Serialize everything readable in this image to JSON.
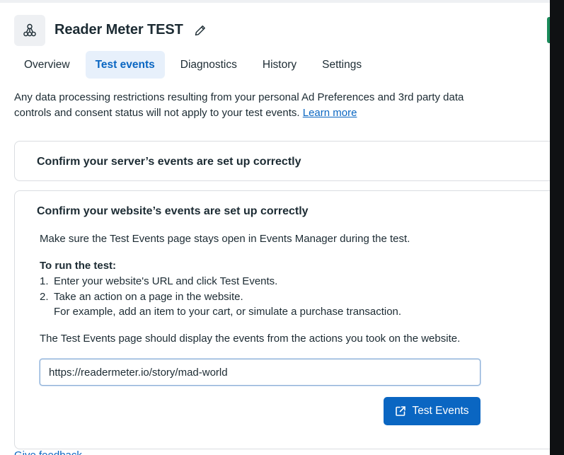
{
  "header": {
    "title": "Reader Meter TEST",
    "icons": {
      "app": "network-nodes-icon",
      "edit": "pencil-icon"
    }
  },
  "tabs": [
    {
      "label": "Overview",
      "active": false
    },
    {
      "label": "Test events",
      "active": true
    },
    {
      "label": "Diagnostics",
      "active": false
    },
    {
      "label": "History",
      "active": false
    },
    {
      "label": "Settings",
      "active": false
    }
  ],
  "notice": {
    "text": "Any data processing restrictions resulting from your personal Ad Preferences and 3rd party data controls and consent status will not apply to your test events.",
    "link": "Learn more"
  },
  "server_card": {
    "title": "Confirm your server’s events are set up correctly"
  },
  "website_card": {
    "title": "Confirm your website’s events are set up correctly",
    "intro": "Make sure the Test Events page stays open in Events Manager during the test.",
    "run_title": "To run the test:",
    "steps": [
      {
        "num": "1.",
        "text": "Enter your website's URL and click Test Events."
      },
      {
        "num": "2.",
        "text": "Take an action on a page in the website.",
        "sub": "For example, add an item to your cart, or simulate a purchase transaction."
      }
    ],
    "outro": "The Test Events page should display the events from the actions you took on the website.",
    "url_value": "https://readermeter.io/story/mad-world",
    "button_label": "Test Events",
    "button_icon": "external-link-icon"
  },
  "footer": {
    "feedback": "Give feedback"
  },
  "colors": {
    "accent": "#0a66c2",
    "tab_active_bg": "#e7f0fb",
    "text": "#1c2b33",
    "border": "#dadde1"
  }
}
